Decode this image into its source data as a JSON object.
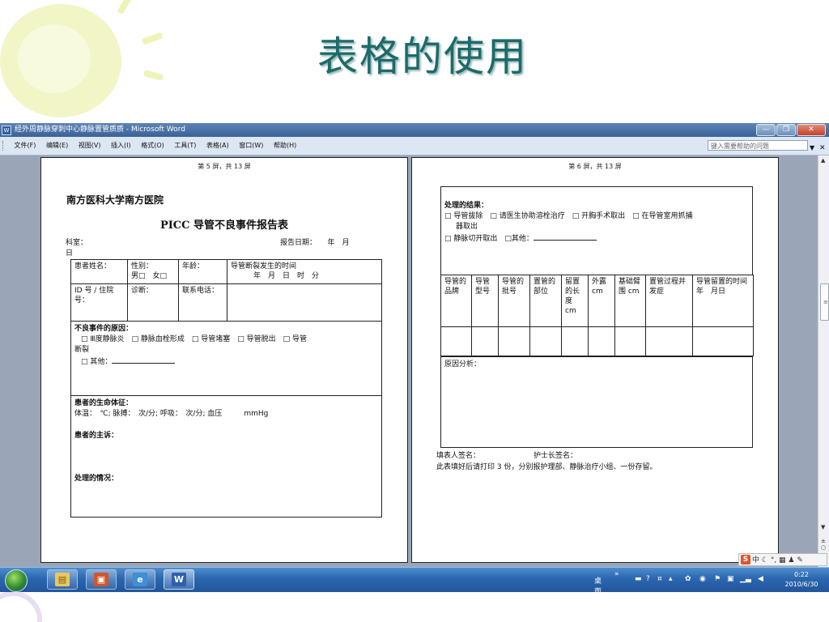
{
  "slide": {
    "title": "表格的使用"
  },
  "window": {
    "title": "经外周静脉穿刺中心静脉置管质质 - Microsoft Word",
    "menu": [
      "文件(F)",
      "编辑(E)",
      "视图(V)",
      "插入(I)",
      "格式(O)",
      "工具(T)",
      "表格(A)",
      "窗口(W)",
      "帮助(H)"
    ],
    "help_placeholder": "键入需要帮助的问题"
  },
  "left_page": {
    "header": "第 5 屏，共 13 屏",
    "hospital": "南方医科大学南方医院",
    "form_title": "PICC 导管不良事件报告表",
    "dept_label": "科室：",
    "report_date": "报告日期：　　年　月",
    "day": "日",
    "row1": {
      "patient_name": "患者姓名：",
      "gender": "性别：",
      "gender_options": "男□　女□",
      "age": "年龄：",
      "rupture_time": "导管断裂发生的时间",
      "time_fields": "年　月　日　时　分"
    },
    "row2": {
      "id_label": "ID 号 / 住院号：",
      "diagnosis": "诊断：",
      "phone": "联系电话："
    },
    "cause": {
      "title": "不良事件的原因：",
      "options": "□ Ⅲ度静脉炎　□ 静脉血栓形成　□ 导管堵塞　□ 导管脱出　□ 导管",
      "wrap": "断裂",
      "other": "□ 其他："
    },
    "vitals": {
      "title": "患者的生命体征：",
      "line": "体温：　℃; 脉搏：　次/分; 呼吸：　次/分; 血压　　　mmHg"
    },
    "complaint": {
      "title": "患者的主诉："
    },
    "handling": {
      "title": "处理的情况："
    }
  },
  "right_page": {
    "header": "第 6 屏，共 13 屏",
    "result": {
      "title": "处理的结果：",
      "line1": "□ 导管拔除　□ 请医生协助溶栓治疗　□ 开胸手术取出　□ 在导管室用抓捕",
      "line1_wrap": "器取出",
      "line2": "□ 静脉切开取出　□其他："
    },
    "columns": [
      "导管的品牌",
      "导管型号",
      "导管的批号",
      "置管的部位",
      "留置的长度 cm",
      "外露 cm",
      "基础臂围 cm",
      "置管过程并发症",
      "导管留置的时间　　年　月日"
    ],
    "analysis": "原因分析：",
    "signer": "填表人签名：",
    "head_nurse": "护士长签名：",
    "note": "此表填好后请打印 3 份，分别报护理部、静脉治疗小组、一份存留。"
  },
  "taskbar": {
    "desktop": "桌面",
    "time": "0:22",
    "date": "2010/6/30"
  },
  "ime": {
    "label": "中"
  }
}
